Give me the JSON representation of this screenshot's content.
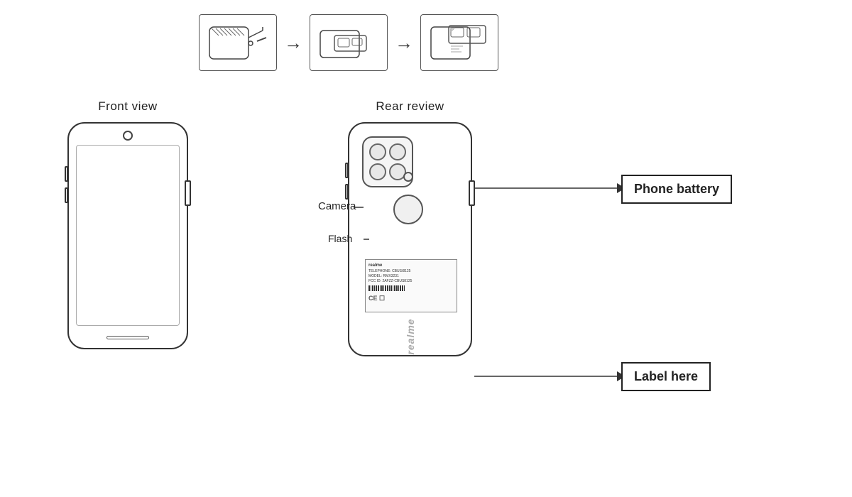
{
  "top_diagrams": {
    "step1_label": "sim-tray-step1",
    "step2_label": "sim-tray-step2",
    "step3_label": "sim-tray-step3",
    "arrow1": "→",
    "arrow2": "→"
  },
  "front_view": {
    "label": "Front view"
  },
  "rear_view": {
    "label": "Rear review"
  },
  "callouts": {
    "camera_label": "Camera",
    "flash_label": "Flash",
    "battery_label": "Phone battery",
    "label_here": "Label here"
  },
  "label_sticker": {
    "brand": "realme",
    "model_line": "TELEPHONE: CBUS/8125",
    "model": "MODEL: RMX3231",
    "fcc_line": "FCC ID: 2AFZZ-CBUS8125",
    "ce_mark": "CE",
    "barcode": "barcode"
  },
  "realme_logo": "realme"
}
